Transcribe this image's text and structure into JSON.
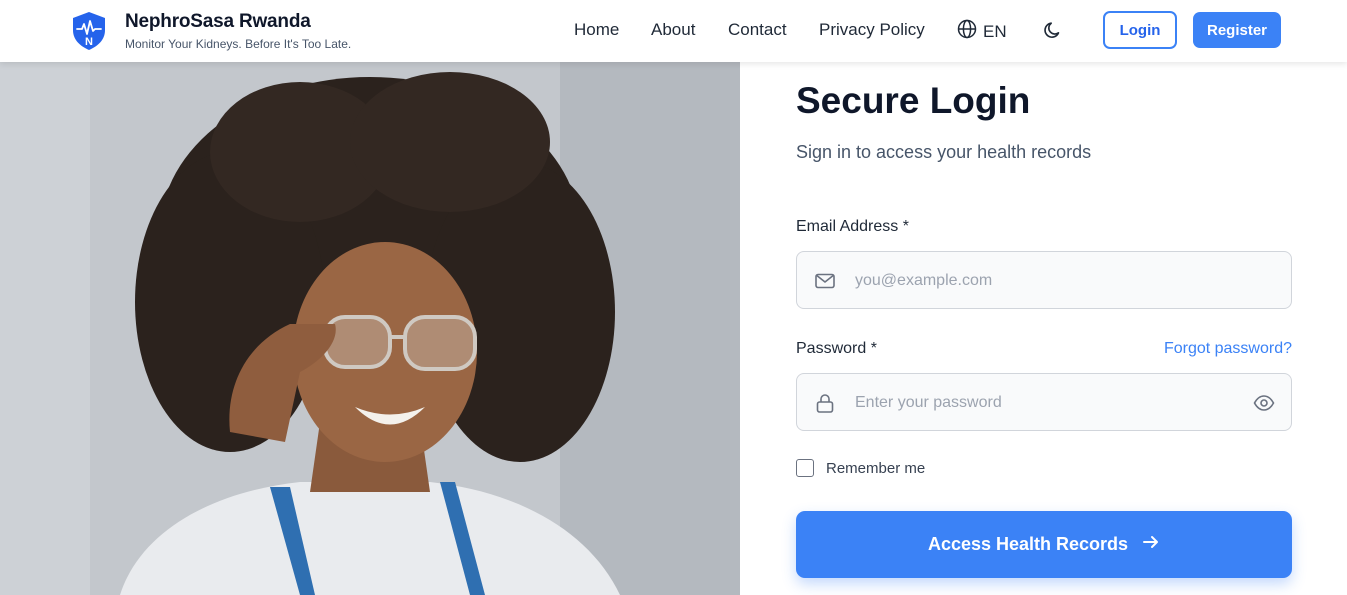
{
  "brand": {
    "name": "NephroSasa Rwanda",
    "tagline": "Monitor Your Kidneys. Before It's Too Late.",
    "logo_letter": "N"
  },
  "nav": {
    "home": "Home",
    "about": "About",
    "contact": "Contact",
    "privacy": "Privacy Policy",
    "language": "EN",
    "login": "Login",
    "register": "Register"
  },
  "login_form": {
    "title": "Secure Login",
    "subtitle": "Sign in to access your health records",
    "email_label": "Email Address *",
    "email_placeholder": "you@example.com",
    "password_label": "Password *",
    "password_placeholder": "Enter your password",
    "forgot_password": "Forgot password?",
    "remember_me": "Remember me",
    "submit": "Access Health Records"
  },
  "icons": {
    "logo": "shield-heartbeat-icon",
    "language": "globe-icon",
    "theme": "moon-icon",
    "email": "mail-icon",
    "password": "lock-icon",
    "show_password": "eye-icon",
    "submit": "arrow-right-icon"
  },
  "colors": {
    "accent": "#3b82f6",
    "accent_dark": "#2563eb",
    "title": "#0f172a",
    "muted": "#475569"
  }
}
